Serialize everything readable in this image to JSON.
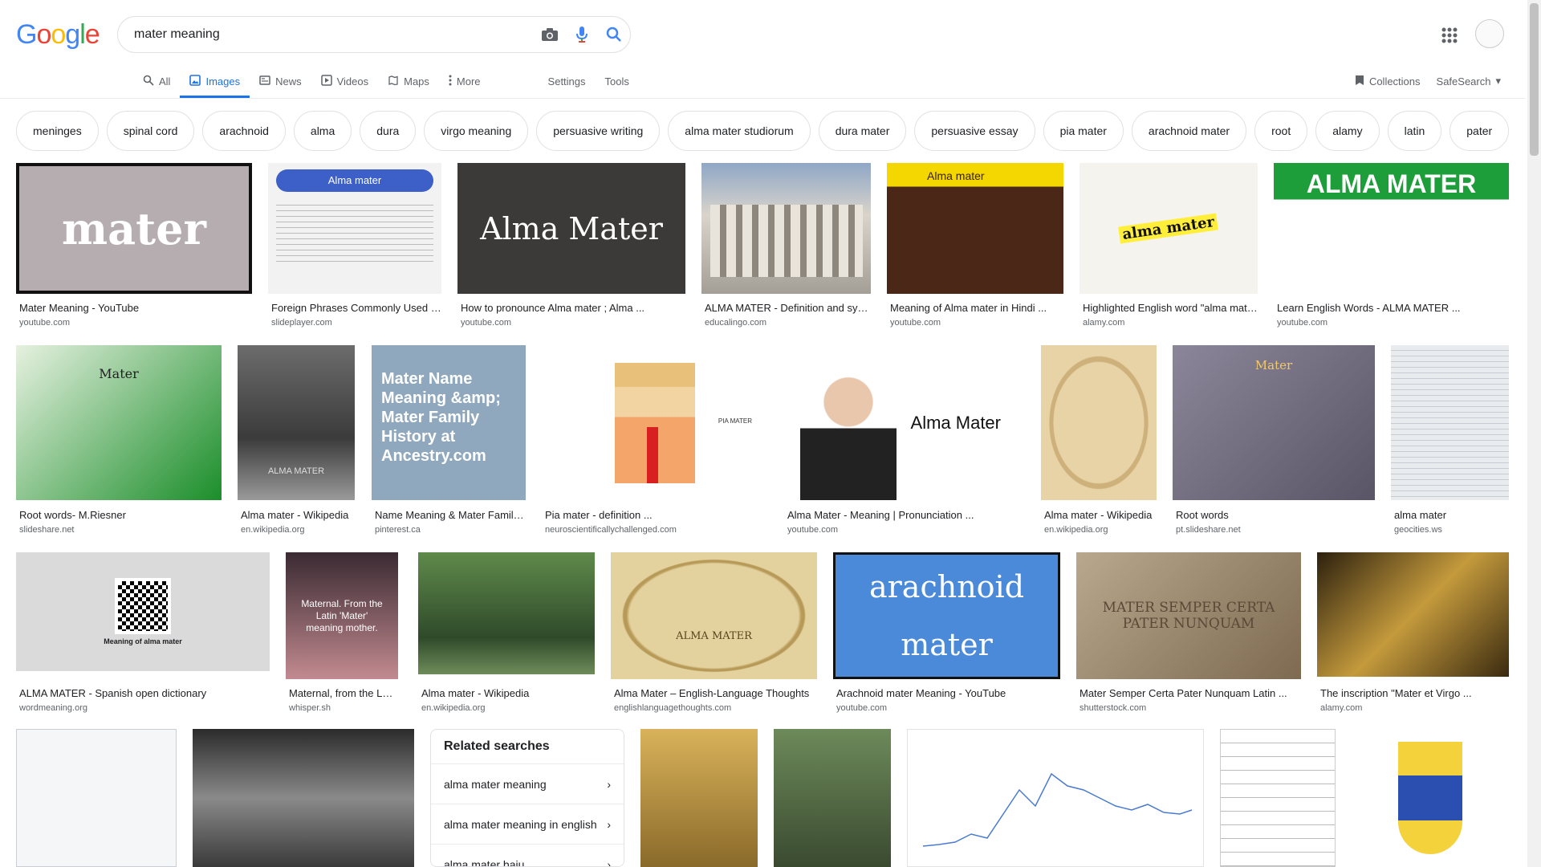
{
  "logo": {
    "text": "Google"
  },
  "search": {
    "value": "mater meaning",
    "placeholder": ""
  },
  "tabs": [
    {
      "label": "All",
      "icon": "search-icon"
    },
    {
      "label": "Images",
      "icon": "image-icon",
      "active": true
    },
    {
      "label": "News",
      "icon": "news-icon"
    },
    {
      "label": "Videos",
      "icon": "video-icon"
    },
    {
      "label": "Maps",
      "icon": "map-icon"
    },
    {
      "label": "More",
      "icon": "more-vert-icon"
    }
  ],
  "tools": {
    "settings": "Settings",
    "tools": "Tools",
    "collections": "Collections",
    "safesearch": "SafeSearch"
  },
  "chips": [
    "meninges",
    "spinal cord",
    "arachnoid",
    "alma",
    "dura",
    "virgo meaning",
    "persuasive writing",
    "alma mater studiorum",
    "dura mater",
    "persuasive essay",
    "pia mater",
    "arachnoid mater",
    "root",
    "alamy",
    "latin",
    "pater"
  ],
  "results": [
    {
      "title": "Mater Meaning - YouTube",
      "source": "youtube.com",
      "thumb_text": "mater"
    },
    {
      "title": "Foreign Phrases Commonly Used i...",
      "source": "slideplayer.com",
      "thumb_text": "Alma mater"
    },
    {
      "title": "How to pronounce Alma mater ; Alma ...",
      "source": "youtube.com",
      "thumb_text": "Alma Mater"
    },
    {
      "title": "ALMA MATER - Definition and syn...",
      "source": "educalingo.com",
      "thumb_text": ""
    },
    {
      "title": "Meaning of Alma mater in Hindi ...",
      "source": "youtube.com",
      "thumb_text": "Alma mater"
    },
    {
      "title": "Highlighted English word \"alma mate...",
      "source": "alamy.com",
      "thumb_text": "alma mater"
    },
    {
      "title": "Learn English Words - ALMA MATER ...",
      "source": "youtube.com",
      "thumb_text": "ALMA MATER"
    },
    {
      "title": "Root words- M.Riesner",
      "source": "slideshare.net",
      "thumb_text": "Mater"
    },
    {
      "title": "Alma mater - Wikipedia",
      "source": "en.wikipedia.org",
      "thumb_text": "ALMA MATER"
    },
    {
      "title": "Name Meaning & Mater Family...",
      "source": "pinterest.ca",
      "thumb_text": "Mater Name Meaning &amp; Mater Family History at Ancestry.com"
    },
    {
      "title": "Pia mater - definition ...",
      "source": "neuroscientificallychallenged.com",
      "thumb_text": "PIA MATER"
    },
    {
      "title": "Alma Mater - Meaning | Pronunciation ...",
      "source": "youtube.com",
      "thumb_text": "Alma Mater"
    },
    {
      "title": "Alma mater - Wikipedia",
      "source": "en.wikipedia.org",
      "thumb_text": ""
    },
    {
      "title": "Root words",
      "source": "pt.slideshare.net",
      "thumb_text": "Mater"
    },
    {
      "title": "alma mater",
      "source": "geocities.ws",
      "thumb_text": ""
    },
    {
      "title": "ALMA MATER - Spanish open dictionary",
      "source": "wordmeaning.org",
      "thumb_text": "Meaning of alma mater"
    },
    {
      "title": "Maternal, from the Lati...",
      "source": "whisper.sh",
      "thumb_text": "Maternal. From the Latin 'Mater' meaning mother."
    },
    {
      "title": "Alma mater - Wikipedia",
      "source": "en.wikipedia.org",
      "thumb_text": ""
    },
    {
      "title": "Alma Mater – English-Language Thoughts",
      "source": "englishlanguagethoughts.com",
      "thumb_text": "ALMA MATER"
    },
    {
      "title": "Arachnoid mater Meaning - YouTube",
      "source": "youtube.com",
      "thumb_text": "arachnoid mater"
    },
    {
      "title": "Mater Semper Certa Pater Nunquam Latin ...",
      "source": "shutterstock.com",
      "thumb_text": "MATER SEMPER CERTA PATER NUNQUAM"
    },
    {
      "title": "The inscription \"Mater et Virgo ...",
      "source": "alamy.com",
      "thumb_text": ""
    }
  ],
  "related": {
    "heading": "Related searches",
    "items": [
      "alma mater meaning",
      "alma mater meaning in english",
      "alma mater baju"
    ]
  }
}
